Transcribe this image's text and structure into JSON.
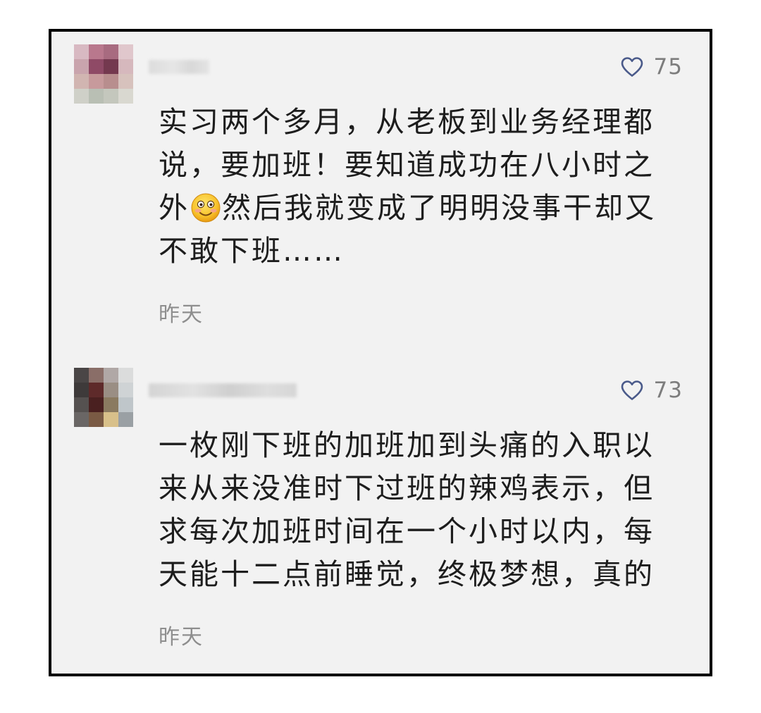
{
  "comments": [
    {
      "like_count": "75",
      "content_before_emoji": "实习两个多月，从老板到业务经理都\n说，要加班！要知道成功在八小时之\n外",
      "emoji": "smiling-face-emoji",
      "content_after_emoji": "然后我就变成了明明没事干却又\n不敢下班……",
      "timestamp": "昨天"
    },
    {
      "like_count": "73",
      "content": "一枚刚下班的加班加到头痛的入职以\n来从来没准时下过班的辣鸡表示，但\n求每次加班时间在一个小时以内，每\n天能十二点前睡觉，终极梦想，真的",
      "timestamp": "昨天"
    }
  ],
  "icons": {
    "like": "heart-outline-icon"
  },
  "colors": {
    "heart": "#4a5a8a",
    "text": "#1d1d1d",
    "meta": "#8e8e8e",
    "background": "#f2f2f2",
    "border": "#000000"
  }
}
